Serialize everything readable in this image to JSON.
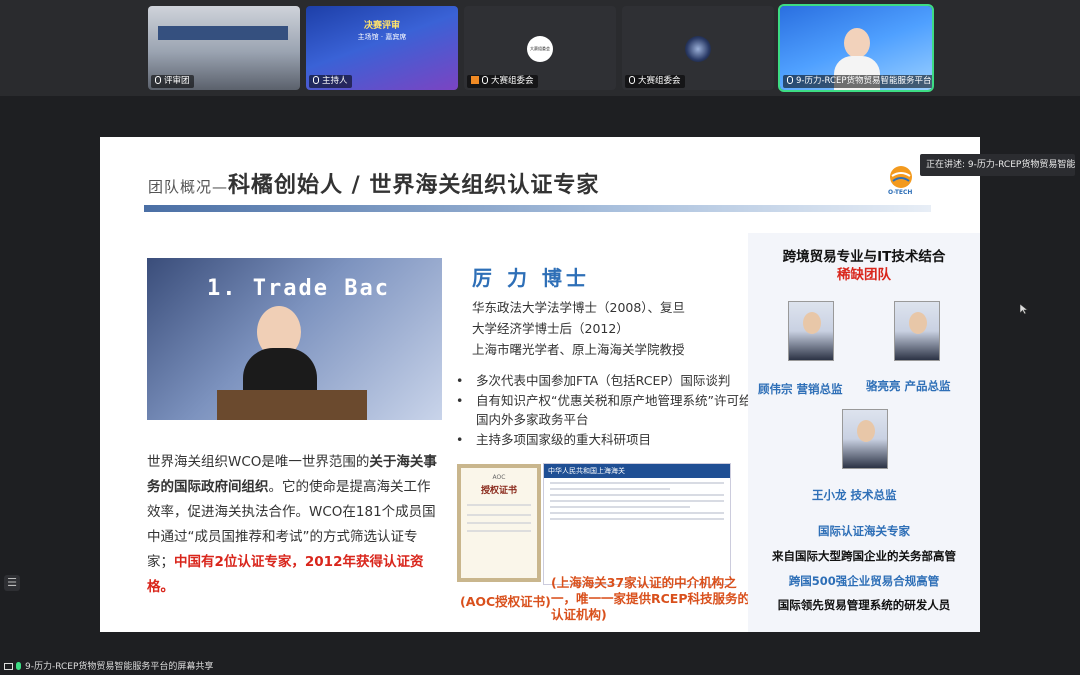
{
  "participants": [
    {
      "name": "评审团"
    },
    {
      "name": "主持人",
      "banner_line1": "决赛评审",
      "banner_line2": "主场馆 · 嘉宾席"
    },
    {
      "name": "大赛组委会",
      "avatar_text": "大赛组委会"
    },
    {
      "name": "大赛组委会"
    },
    {
      "name": "9-历力-RCEP货物贸易智能服务平台"
    }
  ],
  "speaker_tooltip": "正在讲述: 9-历力-RCEP货物贸易智能...",
  "share_bar": "9-历力-RCEP货物贸易智能服务平台的屏幕共享",
  "slide": {
    "title_prefix": "团队概况—",
    "title_main": "科橘创始人 / 世界海关组织认证专家",
    "logo_text": "O-TECH",
    "photo_banner": "1. Trade Bac",
    "person_name": "厉 力 博士",
    "bio": [
      "华东政法大学法学博士（2008）、复旦",
      "大学经济学博士后（2012）",
      "上海市曙光学者、原上海海关学院教授"
    ],
    "bullets": [
      "多次代表中国参加FTA（包括RCEP）国际谈判",
      "自有知识产权“优惠关税和原产地管理系统”许可给国内外多家政务平台",
      "主持多项国家级的重大科研项目"
    ],
    "desc_part1": "世界海关组织WCO是唯一世界范围的",
    "desc_bold": "关于海关事务的国际政府间组织",
    "desc_part2": "。它的使命是提高海关工作效率，促进海关执法合作。WCO在181个成员国中通过“成员国推荐和考试”的方式筛选认证专家；",
    "desc_red": "中国有2位认证专家，2012年获得认证资格。",
    "cert_caption": "(AOC授权证书)",
    "cert_badge": "AOC",
    "cert_title": "授权证书",
    "web_header": "中华人民共和国上海海关",
    "web_caption": "(上海海关37家认证的中介机构之一，唯一一家提供RCEP科技服务的认证机构)"
  },
  "panel": {
    "heading": "跨境贸易专业与IT技术结合",
    "subheading": "稀缺团队",
    "members": [
      {
        "label": "顾伟宗  营销总监"
      },
      {
        "label": "骆亮亮  产品总监"
      },
      {
        "label": "王小龙  技术总监"
      }
    ],
    "texts": [
      {
        "text": "国际认证海关专家",
        "color": "#2e6fb7"
      },
      {
        "text": "来自国际大型跨国企业的关务部高管",
        "color": "#111111"
      },
      {
        "text": "跨国500强企业贸易合规高管",
        "color": "#2e6fb7"
      },
      {
        "text": "国际领先贸易管理系统的研发人员",
        "color": "#111111"
      }
    ]
  },
  "colors": {
    "accent_blue": "#2e6fb7",
    "accent_red": "#d9261c",
    "active_border": "#3ddc84"
  }
}
